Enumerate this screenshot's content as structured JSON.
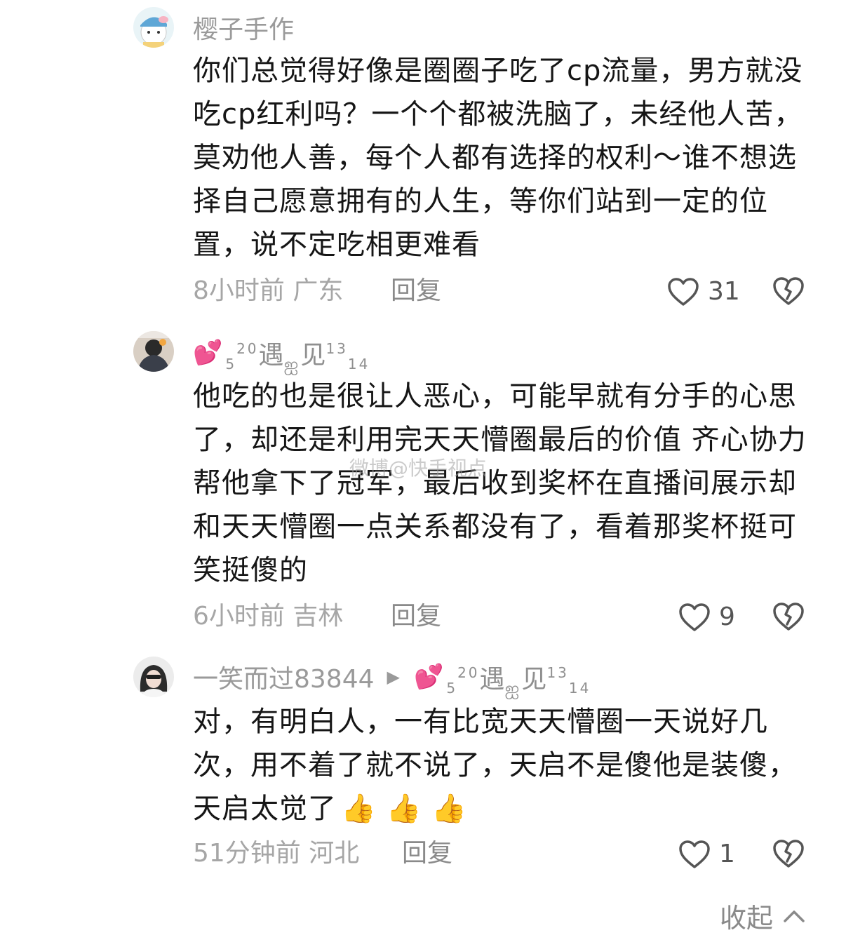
{
  "comments": [
    {
      "author": "樱子手作",
      "text": "你们总觉得好像是圈圈子吃了cp流量，男方就没吃cp红利吗？一个个都被洗脑了，未经他人苦，莫劝他人善，每个人都有选择的权利～谁不想选择自己愿意拥有的人生，等你们站到一定的位置，说不定吃相更难看",
      "time_location": "8小时前 广东",
      "reply_label": "回复",
      "likes": "31"
    },
    {
      "author_prefix": "5",
      "author_sup": "20",
      "author_main_1": "遇",
      "author_deco": "࿫",
      "author_main_2": "见",
      "author_sup_2": "13",
      "author_sub_2": "14",
      "text": "他吃的也是很让人恶心，可能早就有分手的心思了，却还是利用完天天懵圈最后的价值 齐心协力帮他拿下了冠军，最后收到奖杯在直播间展示却和天天懵圈一点关系都没有了，看着那奖杯挺可笑挺傻的",
      "time_location": "6小时前 吉林",
      "reply_label": "回复",
      "likes": "9"
    },
    {
      "author": "一笑而过83844",
      "reply_to_prefix": "5",
      "reply_to_sup": "20",
      "reply_to_main_1": "遇",
      "reply_to_main_2": "见",
      "reply_to_sup_2": "13",
      "reply_to_sub_2": "14",
      "text": "对，有明白人，一有比宽天天懵圈一天说好几次，用不着了就不说了，天启不是傻他是装傻，天启太觉了",
      "time_location": "51分钟前 河北",
      "reply_label": "回复",
      "likes": "1"
    }
  ],
  "watermark": "微博@快手视点",
  "collapse_label": "收起",
  "icons": {
    "like": "heart-outline-icon",
    "dislike": "broken-heart-icon",
    "collapse": "chevron-up-icon",
    "reply_arrow": "play-triangle-icon",
    "emoji_heart": "sparkling-heart-icon",
    "emoji_thumbs": "thumbs-up-icon"
  },
  "colors": {
    "text": "#161616",
    "meta": "#a6a6a6",
    "name": "#9a9a9a",
    "heart_emoji": "#e5337c",
    "thumbs": "#f3b21a"
  }
}
